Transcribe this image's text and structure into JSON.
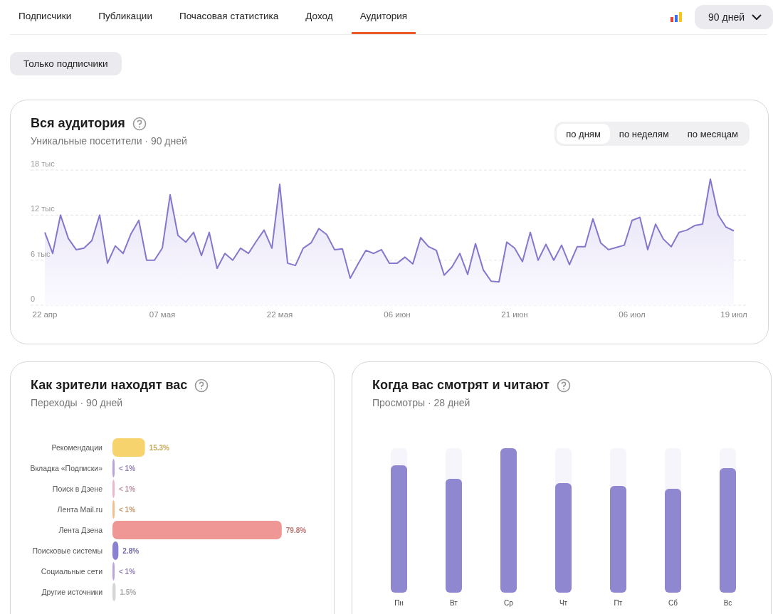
{
  "tabs": [
    {
      "label": "Подписчики",
      "selected": false
    },
    {
      "label": "Публикации",
      "selected": false
    },
    {
      "label": "Почасовая статистика",
      "selected": false
    },
    {
      "label": "Доход",
      "selected": false
    },
    {
      "label": "Аудитория",
      "selected": true
    }
  ],
  "period": {
    "label": "90 дней"
  },
  "filter_button": "Только подписчики",
  "audience": {
    "title": "Вся аудитория",
    "subtitle": "Уникальные посетители · 90 дней",
    "granularity": [
      {
        "label": "по дням",
        "selected": true
      },
      {
        "label": "по неделям",
        "selected": false
      },
      {
        "label": "по месяцам",
        "selected": false
      }
    ],
    "chart_data": {
      "type": "area",
      "categories": [
        "22 апр",
        null,
        null,
        null,
        null,
        null,
        null,
        null,
        null,
        null,
        null,
        null,
        null,
        null,
        null,
        "07 мая",
        null,
        null,
        null,
        null,
        null,
        null,
        null,
        null,
        null,
        null,
        null,
        null,
        null,
        null,
        "22 мая",
        null,
        null,
        null,
        null,
        null,
        null,
        null,
        null,
        null,
        null,
        null,
        null,
        null,
        null,
        "06 июн",
        null,
        null,
        null,
        null,
        null,
        null,
        null,
        null,
        null,
        null,
        null,
        null,
        null,
        null,
        "21 июн",
        null,
        null,
        null,
        null,
        null,
        null,
        null,
        null,
        null,
        null,
        null,
        null,
        null,
        null,
        "06 июл",
        null,
        null,
        null,
        null,
        null,
        null,
        null,
        null,
        null,
        null,
        null,
        null,
        "19 июл"
      ],
      "ylim": [
        0,
        18
      ],
      "yticks": [
        {
          "value": 0,
          "label": "0"
        },
        {
          "value": 6,
          "label": "6 тыс"
        },
        {
          "value": 12,
          "label": "12 тыс"
        },
        {
          "value": 18,
          "label": "18 тыс"
        }
      ],
      "series": [
        {
          "color": "#8477cc",
          "values": [
            9.7,
            6.9,
            12,
            8.9,
            7.4,
            7.6,
            8.6,
            12,
            5.6,
            7.9,
            6.9,
            9.5,
            11.3,
            6.0,
            6.0,
            7.6,
            14.7,
            9.3,
            8.4,
            9.7,
            6.6,
            9.7,
            4.9,
            6.9,
            6.0,
            7.6,
            6.9,
            8.5,
            10,
            7.6,
            16.1,
            5.6,
            5.3,
            7.6,
            8.3,
            10.2,
            9.4,
            7.4,
            7.5,
            3.6,
            5.5,
            7.3,
            6.9,
            7.4,
            5.6,
            5.6,
            6.4,
            5.5,
            9,
            7.8,
            7.3,
            4,
            5.1,
            6.9,
            4.1,
            8.2,
            4.7,
            3.2,
            3.1,
            8.4,
            7.6,
            5.8,
            9.7,
            6.0,
            8.1,
            6.0,
            8.0,
            5.4,
            7.8,
            7.8,
            11.5,
            8.3,
            7.4,
            7.7,
            8.0,
            11.3,
            11.7,
            7.4,
            10.8,
            8.8,
            7.8,
            9.7,
            10,
            10.6,
            10.8,
            16.8,
            12,
            10.4,
            9.9
          ]
        }
      ]
    }
  },
  "sources_card": {
    "title": "Как зрители находят вас",
    "subtitle": "Переходы · 90 дней",
    "chart_data": {
      "type": "bar",
      "orientation": "horizontal",
      "categories": [
        "Рекомендации",
        "Вкладка «Подписки»",
        "Поиск в Дзене",
        "Лента Mail.ru",
        "Лента Дзена",
        "Поисковые системы",
        "Социальные сети",
        "Другие источники"
      ],
      "value_labels": [
        "15.3%",
        "< 1%",
        "< 1%",
        "< 1%",
        "79.8%",
        "2.8%",
        "< 1%",
        "1.5%"
      ],
      "colors": [
        "#f7d36e",
        "#b8a1dd",
        "#ebb5cd",
        "#f2bf8c",
        "#ee9794",
        "#8a82d0",
        "#bea4df",
        "#d6d6d6"
      ],
      "values": [
        15.3,
        0.9,
        0.9,
        0.9,
        79.8,
        2.8,
        0.9,
        1.5
      ]
    }
  },
  "time_card": {
    "title": "Когда вас смотрят и читают",
    "subtitle": "Просмотры · 28 дней",
    "days": [
      {
        "label": "Пн",
        "level": 0.88
      },
      {
        "label": "Вт",
        "level": 0.79
      },
      {
        "label": "Ср",
        "level": 1.0
      },
      {
        "label": "Чт",
        "level": 0.76
      },
      {
        "label": "Пт",
        "level": 0.74
      },
      {
        "label": "Сб",
        "level": 0.72
      },
      {
        "label": "Вс",
        "level": 0.86
      }
    ]
  }
}
